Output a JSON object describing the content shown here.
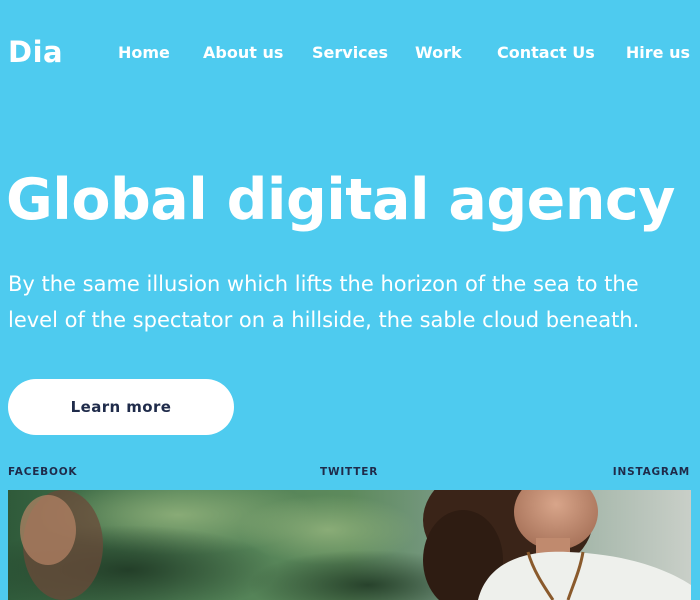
{
  "header": {
    "logo": "Dia",
    "nav": [
      {
        "label": "Home"
      },
      {
        "label": "About us"
      },
      {
        "label": "Services"
      },
      {
        "label": "Work"
      },
      {
        "label": "Contact Us"
      }
    ],
    "hire_label": "Hire us"
  },
  "hero": {
    "title": "Global digital agency",
    "subtitle": "By the same illusion which lifts the horizon of the sea to the level of the spectator on a hillside, the sable cloud beneath.",
    "cta_label": "Learn more"
  },
  "social": {
    "facebook": "FACEBOOK",
    "twitter": "TWITTER",
    "instagram": "INSTAGRAM"
  },
  "colors": {
    "background": "#4ecbef",
    "text": "#ffffff",
    "button_text": "#1f2b4a"
  }
}
